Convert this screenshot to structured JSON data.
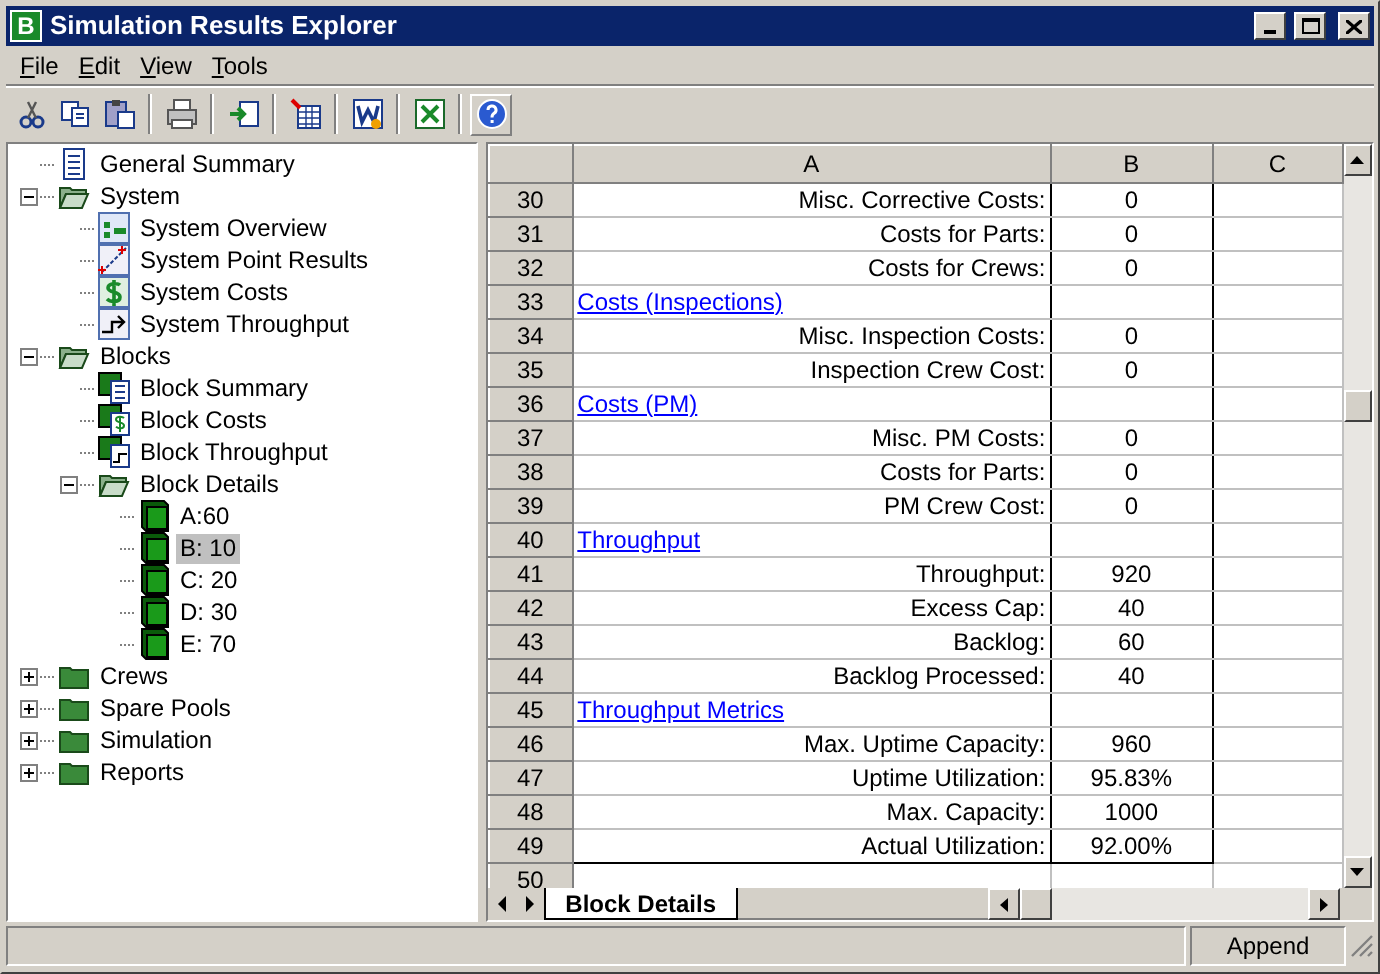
{
  "window": {
    "logo": "B",
    "title": "Simulation Results Explorer"
  },
  "menu": [
    {
      "label": "File"
    },
    {
      "label": "Edit"
    },
    {
      "label": "View"
    },
    {
      "label": "Tools"
    }
  ],
  "tree": [
    {
      "label": "General Summary",
      "kind": "report",
      "selected": false
    },
    {
      "label": "System",
      "kind": "folder",
      "expanded": true,
      "selected": false,
      "children": [
        {
          "label": "System Overview",
          "kind": "overview",
          "selected": false
        },
        {
          "label": "System Point Results",
          "kind": "points",
          "selected": false
        },
        {
          "label": "System Costs",
          "kind": "costs",
          "selected": false
        },
        {
          "label": "System Throughput",
          "kind": "throughput",
          "selected": false
        }
      ]
    },
    {
      "label": "Blocks",
      "kind": "folder",
      "expanded": true,
      "selected": false,
      "children": [
        {
          "label": "Block Summary",
          "kind": "block-report",
          "selected": false
        },
        {
          "label": "Block Costs",
          "kind": "block-costs",
          "selected": false
        },
        {
          "label": "Block Throughput",
          "kind": "block-throughput",
          "selected": false
        },
        {
          "label": "Block Details",
          "kind": "folder",
          "expanded": true,
          "selected": false,
          "children": [
            {
              "label": "A:60",
              "kind": "block",
              "selected": false
            },
            {
              "label": "B: 10",
              "kind": "block",
              "selected": true
            },
            {
              "label": "C: 20",
              "kind": "block",
              "selected": false
            },
            {
              "label": "D: 30",
              "kind": "block",
              "selected": false
            },
            {
              "label": "E: 70",
              "kind": "block",
              "selected": false
            }
          ]
        }
      ]
    },
    {
      "label": "Crews",
      "kind": "folder",
      "expanded": false,
      "selected": false
    },
    {
      "label": "Spare Pools",
      "kind": "folder",
      "expanded": false,
      "selected": false
    },
    {
      "label": "Simulation",
      "kind": "folder",
      "expanded": false,
      "selected": false
    },
    {
      "label": "Reports",
      "kind": "folder",
      "expanded": false,
      "selected": false
    }
  ],
  "sheet": {
    "columns": [
      "A",
      "B",
      "C"
    ],
    "rows": [
      {
        "number": "30",
        "kind": "item",
        "label": "Misc. Corrective Costs:",
        "value": "0"
      },
      {
        "number": "31",
        "kind": "item",
        "label": "Costs for Parts:",
        "value": "0"
      },
      {
        "number": "32",
        "kind": "item",
        "label": "Costs for Crews:",
        "value": "0"
      },
      {
        "number": "33",
        "kind": "heading",
        "label": "Costs (Inspections)"
      },
      {
        "number": "34",
        "kind": "item",
        "label": "Misc. Inspection Costs:",
        "value": "0"
      },
      {
        "number": "35",
        "kind": "item",
        "label": "Inspection Crew Cost:",
        "value": "0"
      },
      {
        "number": "36",
        "kind": "heading",
        "label": "Costs (PM)"
      },
      {
        "number": "37",
        "kind": "item",
        "label": "Misc. PM Costs:",
        "value": "0"
      },
      {
        "number": "38",
        "kind": "item",
        "label": "Costs for Parts:",
        "value": "0"
      },
      {
        "number": "39",
        "kind": "item",
        "label": "PM Crew Cost:",
        "value": "0"
      },
      {
        "number": "40",
        "kind": "heading",
        "label": "Throughput"
      },
      {
        "number": "41",
        "kind": "item",
        "label": "Throughput:",
        "value": "920"
      },
      {
        "number": "42",
        "kind": "item",
        "label": "Excess Cap:",
        "value": "40"
      },
      {
        "number": "43",
        "kind": "item",
        "label": "Backlog:",
        "value": "60"
      },
      {
        "number": "44",
        "kind": "item",
        "label": "Backlog Processed:",
        "value": "40"
      },
      {
        "number": "45",
        "kind": "heading",
        "label": "Throughput Metrics"
      },
      {
        "number": "46",
        "kind": "item",
        "label": "Max. Uptime Capacity:",
        "value": "960"
      },
      {
        "number": "47",
        "kind": "item",
        "label": "Uptime Utilization:",
        "value": "95.83%"
      },
      {
        "number": "48",
        "kind": "item",
        "label": "Max. Capacity:",
        "value": "1000"
      },
      {
        "number": "49",
        "kind": "item",
        "label": "Actual Utilization:",
        "value": "92.00%"
      },
      {
        "number": "50",
        "kind": "blank"
      }
    ],
    "tabs": [
      {
        "label": "Block Details",
        "selected": true
      }
    ]
  },
  "status_bar": {
    "button": "Append"
  }
}
